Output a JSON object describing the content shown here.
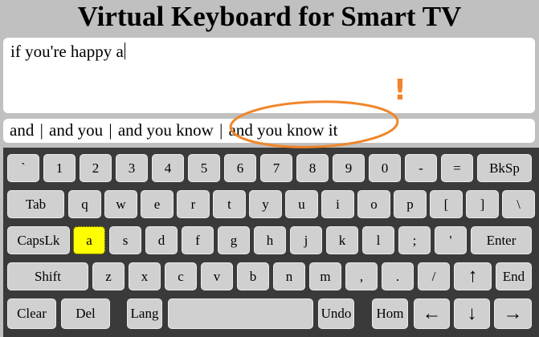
{
  "title": "Virtual Keyboard for Smart TV",
  "input": {
    "value": "if you're happy a"
  },
  "suggestions": [
    "and",
    "and you",
    "and you know",
    "and you know it"
  ],
  "suggestion_separator": "|",
  "keyboard": {
    "active_key": "a",
    "active_color": "#ffff00",
    "rows": [
      [
        "`",
        "1",
        "2",
        "3",
        "4",
        "5",
        "6",
        "7",
        "8",
        "9",
        "0",
        "-",
        "=",
        "BkSp"
      ],
      [
        "Tab",
        "q",
        "w",
        "e",
        "r",
        "t",
        "y",
        "u",
        "i",
        "o",
        "p",
        "[",
        "]",
        "\\"
      ],
      [
        "CapsLk",
        "a",
        "s",
        "d",
        "f",
        "g",
        "h",
        "j",
        "k",
        "l",
        ";",
        "'",
        "Enter"
      ],
      [
        "Shift",
        "z",
        "x",
        "c",
        "v",
        "b",
        "n",
        "m",
        ",",
        ".",
        "/",
        "↑",
        "End"
      ],
      [
        "Clear",
        "Del",
        "Lang",
        "",
        "Undo",
        "Hom",
        "←",
        "↓",
        "→"
      ]
    ]
  },
  "annotation": {
    "mark": "!",
    "color": "#f0862a"
  }
}
